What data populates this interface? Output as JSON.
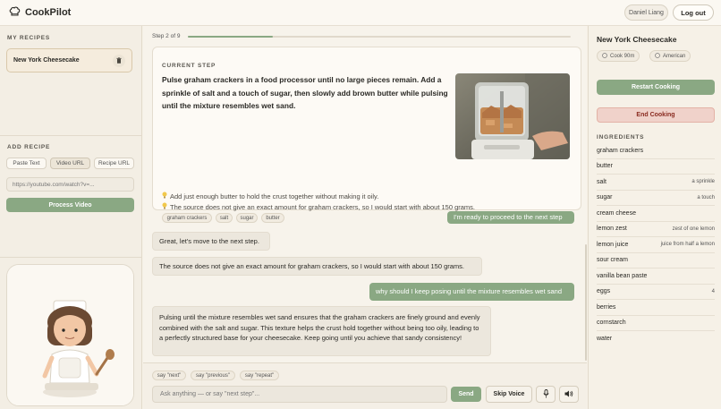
{
  "header": {
    "app_name": "CookPilot",
    "user_name": "Daniel Liang",
    "logout_label": "Log out"
  },
  "left": {
    "my_recipes_title": "MY RECIPES",
    "recipes": [
      {
        "name": "New York Cheesecake"
      }
    ],
    "add_recipe_title": "ADD RECIPE",
    "tabs": [
      "Paste Text",
      "Video URL",
      "Recipe URL"
    ],
    "active_tab": "Video URL",
    "url_value": "https://youtube.com/watch?v=...",
    "process_label": "Process Video"
  },
  "center": {
    "step_label": "Step 2 of 9",
    "progress_fraction": 0.222,
    "current_step_title": "CURRENT STEP",
    "current_step_text": "Pulse graham crackers in a food processor until no large pieces remain. Add a sprinkle of salt and a touch of sugar, then slowly add brown butter while pulsing until the mixture resembles wet sand.",
    "tips": [
      "Add just enough butter to hold the crust together without making it oily.",
      "The source does not give an exact amount for graham crackers, so I would start with about 150 grams."
    ],
    "tags": [
      "graham crackers",
      "salt",
      "sugar",
      "butter"
    ],
    "messages": [
      {
        "role": "user",
        "text": "I'm ready to proceed to the next step"
      },
      {
        "role": "bot",
        "text": "Great, let's move to the next step."
      },
      {
        "role": "bot",
        "text": "The source does not give an exact amount for graham crackers, so I would start with about 150 grams."
      },
      {
        "role": "user",
        "text": "why should I keep posing until the mixture resembles wet sand"
      },
      {
        "role": "bot",
        "text": "Pulsing until the mixture resembles wet sand ensures that the graham crackers are finely ground and evenly combined with the salt and sugar. This texture helps the crust hold together without being too oily, leading to a perfectly structured base for your cheesecake. Keep going until you achieve that sandy consistency!"
      }
    ],
    "quick_chips": [
      "say \"next\"",
      "say \"previous\"",
      "say \"repeat\""
    ],
    "input_placeholder": "Ask anything — or say \"next step\"...",
    "send_label": "Send",
    "skip_voice_label": "Skip Voice"
  },
  "right": {
    "recipe_title": "New York Cheesecake",
    "cook_time": "Cook 90m",
    "cuisine": "American",
    "restart_label": "Restart Cooking",
    "end_label": "End Cooking",
    "ingredients_title": "INGREDIENTS",
    "ingredients": [
      {
        "name": "graham crackers",
        "amount": ""
      },
      {
        "name": "butter",
        "amount": ""
      },
      {
        "name": "salt",
        "amount": "a sprinkle"
      },
      {
        "name": "sugar",
        "amount": "a touch"
      },
      {
        "name": "cream cheese",
        "amount": ""
      },
      {
        "name": "lemon zest",
        "amount": "zest of one lemon"
      },
      {
        "name": "lemon juice",
        "amount": "juice from half a lemon"
      },
      {
        "name": "sour cream",
        "amount": ""
      },
      {
        "name": "vanilla bean paste",
        "amount": ""
      },
      {
        "name": "eggs",
        "amount": "4"
      },
      {
        "name": "berries",
        "amount": ""
      },
      {
        "name": "cornstarch",
        "amount": ""
      },
      {
        "name": "water",
        "amount": ""
      }
    ]
  },
  "colors": {
    "accent_green": "#8aa883",
    "danger_bg": "#f0d2ca",
    "danger_text": "#8a2b20",
    "background": "#f6f1e7"
  }
}
